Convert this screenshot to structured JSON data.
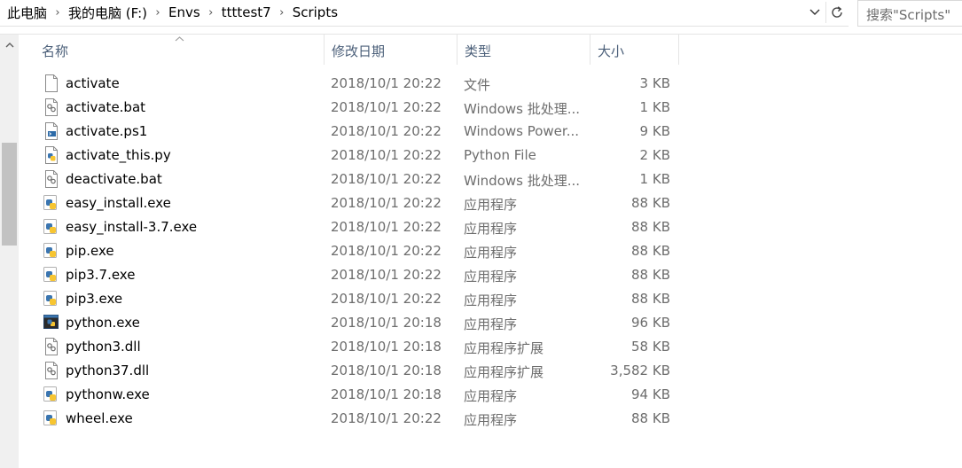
{
  "address": {
    "crumbs": [
      "此电脑",
      "我的电脑 (F:)",
      "Envs",
      "ttttest7",
      "Scripts"
    ],
    "separator": "›"
  },
  "search": {
    "placeholder": "搜索\"Scripts\""
  },
  "columns": {
    "name": "名称",
    "date": "修改日期",
    "type": "类型",
    "size": "大小"
  },
  "files": [
    {
      "icon": "blank-file-icon",
      "name": "activate",
      "date": "2018/10/1 20:22",
      "type": "文件",
      "size": "3 KB"
    },
    {
      "icon": "batch-file-icon",
      "name": "activate.bat",
      "date": "2018/10/1 20:22",
      "type": "Windows 批处理...",
      "size": "1 KB"
    },
    {
      "icon": "powershell-file-icon",
      "name": "activate.ps1",
      "date": "2018/10/1 20:22",
      "type": "Windows Power...",
      "size": "9 KB"
    },
    {
      "icon": "python-file-icon",
      "name": "activate_this.py",
      "date": "2018/10/1 20:22",
      "type": "Python File",
      "size": "2 KB"
    },
    {
      "icon": "batch-file-icon",
      "name": "deactivate.bat",
      "date": "2018/10/1 20:22",
      "type": "Windows 批处理...",
      "size": "1 KB"
    },
    {
      "icon": "python-exe-icon",
      "name": "easy_install.exe",
      "date": "2018/10/1 20:22",
      "type": "应用程序",
      "size": "88 KB"
    },
    {
      "icon": "python-exe-icon",
      "name": "easy_install-3.7.exe",
      "date": "2018/10/1 20:22",
      "type": "应用程序",
      "size": "88 KB"
    },
    {
      "icon": "python-exe-icon",
      "name": "pip.exe",
      "date": "2018/10/1 20:22",
      "type": "应用程序",
      "size": "88 KB"
    },
    {
      "icon": "python-exe-icon",
      "name": "pip3.7.exe",
      "date": "2018/10/1 20:22",
      "type": "应用程序",
      "size": "88 KB"
    },
    {
      "icon": "python-exe-icon",
      "name": "pip3.exe",
      "date": "2018/10/1 20:22",
      "type": "应用程序",
      "size": "88 KB"
    },
    {
      "icon": "python-console-icon",
      "name": "python.exe",
      "date": "2018/10/1 20:18",
      "type": "应用程序",
      "size": "96 KB"
    },
    {
      "icon": "dll-file-icon",
      "name": "python3.dll",
      "date": "2018/10/1 20:18",
      "type": "应用程序扩展",
      "size": "58 KB"
    },
    {
      "icon": "dll-file-icon",
      "name": "python37.dll",
      "date": "2018/10/1 20:18",
      "type": "应用程序扩展",
      "size": "3,582 KB"
    },
    {
      "icon": "python-exe-icon",
      "name": "pythonw.exe",
      "date": "2018/10/1 20:18",
      "type": "应用程序",
      "size": "94 KB"
    },
    {
      "icon": "python-exe-icon",
      "name": "wheel.exe",
      "date": "2018/10/1 20:22",
      "type": "应用程序",
      "size": "88 KB"
    }
  ],
  "colors": {
    "header_text": "#4c607a",
    "detail_text": "#6d6d6d",
    "python_blue": "#3a75b0",
    "python_yellow": "#f7c531"
  }
}
